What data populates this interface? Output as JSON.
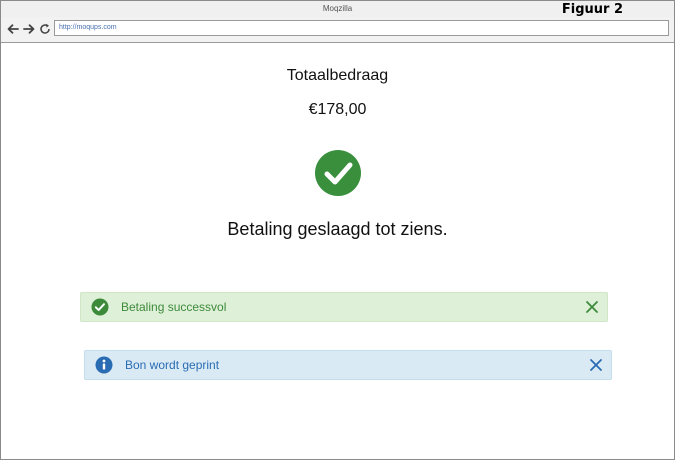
{
  "window": {
    "title": "Moqzilla",
    "figure_label": "Figuur 2"
  },
  "browser": {
    "url": "http://moqups.com"
  },
  "payment": {
    "total_label": "Totaalbedraag",
    "total_amount": "€178,00",
    "message": "Betaling geslaagd tot ziens."
  },
  "alerts": [
    {
      "text": "Betaling successvol",
      "type": "success",
      "color": "#3c8a3a",
      "icon": "check-circle-icon"
    },
    {
      "text": "Bon wordt geprint",
      "type": "info",
      "color": "#2a6cb3",
      "icon": "info-icon"
    }
  ],
  "colors": {
    "success": "#3c8a3a",
    "info": "#2a6cb3",
    "success_bg": "#dff0d8",
    "info_bg": "#d9eaf5"
  }
}
